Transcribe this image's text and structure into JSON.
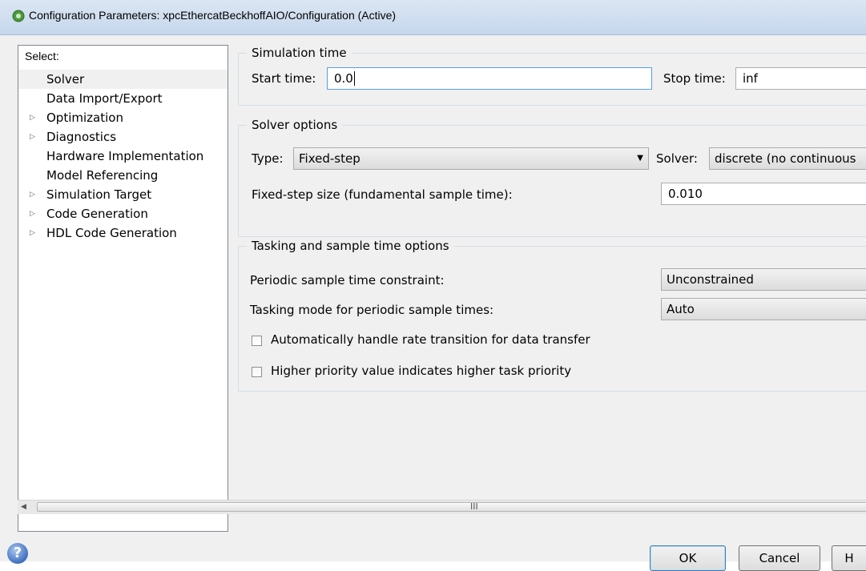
{
  "window": {
    "title": "Configuration Parameters: xpcEthercatBeckhoffAIO/Configuration (Active)",
    "icon": "gear-icon"
  },
  "sidebar": {
    "select_label": "Select:",
    "items": [
      {
        "label": "Solver",
        "expandable": false,
        "selected": true
      },
      {
        "label": "Data Import/Export",
        "expandable": false
      },
      {
        "label": "Optimization",
        "expandable": true
      },
      {
        "label": "Diagnostics",
        "expandable": true
      },
      {
        "label": "Hardware Implementation",
        "expandable": false
      },
      {
        "label": "Model Referencing",
        "expandable": false
      },
      {
        "label": "Simulation Target",
        "expandable": true
      },
      {
        "label": "Code Generation",
        "expandable": true
      },
      {
        "label": "HDL Code Generation",
        "expandable": true
      }
    ]
  },
  "simulation_time": {
    "title": "Simulation time",
    "start_label": "Start time:",
    "start_value": "0.0",
    "stop_label": "Stop time:",
    "stop_value": "inf"
  },
  "solver_options": {
    "title": "Solver options",
    "type_label": "Type:",
    "type_value": "Fixed-step",
    "solver_label": "Solver:",
    "solver_value": "discrete (no continuous",
    "step_size_label": "Fixed-step size (fundamental sample time):",
    "step_size_value": "0.010"
  },
  "tasking": {
    "title": "Tasking and sample time options",
    "periodic_label": "Periodic sample time constraint:",
    "periodic_value": "Unconstrained",
    "tasking_mode_label": "Tasking mode for periodic sample times:",
    "tasking_mode_value": "Auto",
    "auto_rate_label": "Automatically handle rate transition for data transfer",
    "higher_priority_label": "Higher priority value indicates higher task priority"
  },
  "scrollbar": {
    "grip": "III"
  },
  "buttons": {
    "ok": "OK",
    "cancel": "Cancel",
    "help": "H",
    "help_icon_glyph": "?"
  }
}
